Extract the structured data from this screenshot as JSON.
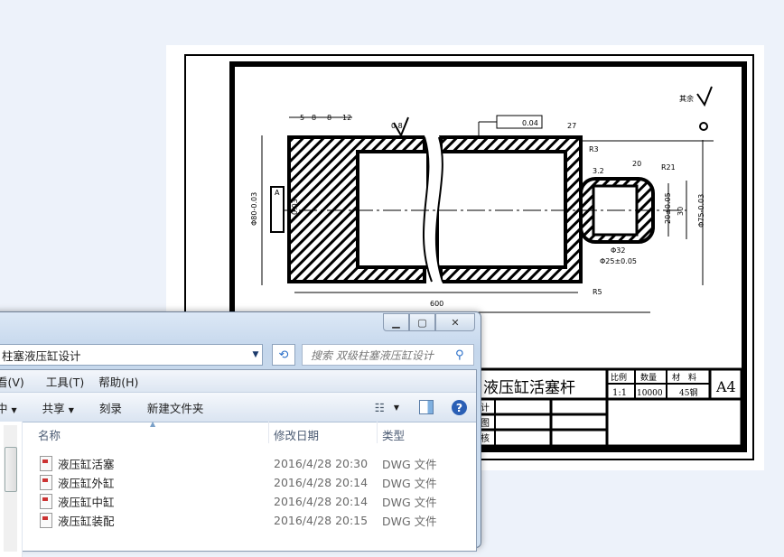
{
  "drawing": {
    "title": "液压缸活塞杆",
    "labels": {
      "scale_header": "比例",
      "qty_header": "数量",
      "material_header": "材　料",
      "scale": "1:1",
      "qty": "10000",
      "material": "45钢",
      "size": "A4",
      "row1": "计",
      "row2": "图",
      "row3": "核",
      "remaining_roughness": "其余",
      "runout_tol": "0.04",
      "flat_tol": "0.03",
      "datum": "A",
      "dim_5": "5",
      "dim_8a": "8",
      "dim_8b": "8",
      "dim_12": "12",
      "dim_27": "27",
      "dim_20": "20",
      "dim_600": "600",
      "dim_r21": "R21",
      "dim_r5": "R5",
      "dim_r3": "R3",
      "dim_phi32": "Φ32",
      "dim_phi25": "Φ25±0.05",
      "dim_30": "30",
      "dim_20b": "20±0.05",
      "dim_phi75": "Φ75-0.03",
      "dim_phi80": "Φ80-0.03",
      "roughness_08": "0.8",
      "roughness_32": "3.2"
    }
  },
  "explorer": {
    "caption_buttons": [
      "minimize",
      "maximize",
      "close"
    ],
    "address": "柱塞液压缸设计",
    "search_placeholder": "搜索 双级柱塞液压缸设计",
    "menu": [
      "看(V)",
      "工具(T)",
      "帮助(H)"
    ],
    "toolbar": {
      "include": "中",
      "share": "共享",
      "burn": "刻录",
      "new_folder": "新建文件夹"
    },
    "columns": {
      "name": "名称",
      "date": "修改日期",
      "type": "类型"
    },
    "files": [
      {
        "name": "液压缸活塞",
        "date": "2016/4/28 20:30",
        "type": "DWG 文件"
      },
      {
        "name": "液压缸外缸",
        "date": "2016/4/28 20:14",
        "type": "DWG 文件"
      },
      {
        "name": "液压缸中缸",
        "date": "2016/4/28 20:14",
        "type": "DWG 文件"
      },
      {
        "name": "液压缸装配",
        "date": "2016/4/28 20:15",
        "type": "DWG 文件"
      }
    ]
  },
  "colors": {
    "desktop": "#edf2fa",
    "accent": "#2a6fc9"
  }
}
